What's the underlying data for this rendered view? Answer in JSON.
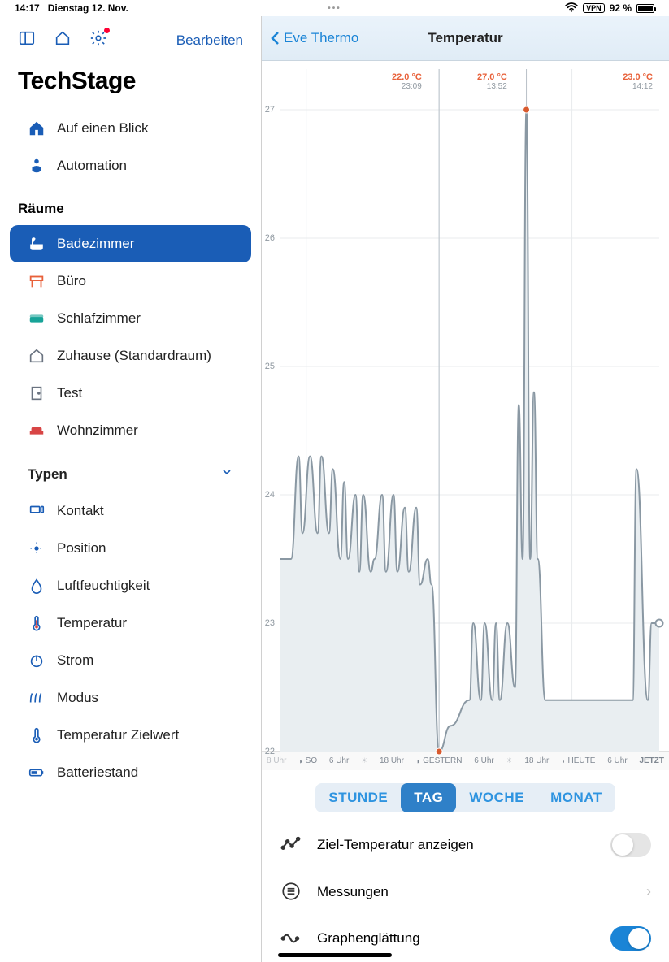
{
  "statusbar": {
    "time": "14:17",
    "date": "Dienstag 12. Nov.",
    "vpn": "VPN",
    "battery": "92 %"
  },
  "sidebar": {
    "edit": "Bearbeiten",
    "app_title": "TechStage",
    "top": [
      {
        "label": "Auf einen Blick"
      },
      {
        "label": "Automation"
      }
    ],
    "rooms_header": "Räume",
    "rooms": [
      {
        "label": "Badezimmer"
      },
      {
        "label": "Büro"
      },
      {
        "label": "Schlafzimmer"
      },
      {
        "label": "Zuhause (Standardraum)"
      },
      {
        "label": "Test"
      },
      {
        "label": "Wohnzimmer"
      }
    ],
    "types_header": "Typen",
    "types": [
      {
        "label": "Kontakt"
      },
      {
        "label": "Position"
      },
      {
        "label": "Luftfeuchtigkeit"
      },
      {
        "label": "Temperatur"
      },
      {
        "label": "Strom"
      },
      {
        "label": "Modus"
      },
      {
        "label": "Temperatur Zielwert"
      },
      {
        "label": "Batteriestand"
      }
    ]
  },
  "content": {
    "back": "Eve Thermo",
    "title": "Temperatur",
    "annotations": [
      {
        "temp": "22.0 °C",
        "time": "23:09"
      },
      {
        "temp": "27.0 °C",
        "time": "13:52"
      },
      {
        "temp": "23.0 °C",
        "time": "14:12"
      }
    ],
    "xaxis": {
      "so": "SO",
      "gestern": "GESTERN",
      "heute": "HEUTE",
      "six": "6 Uhr",
      "eighteen": "18 Uhr",
      "jetzt": "JETZT",
      "eight": "8 Uhr"
    },
    "seg": {
      "hour": "STUNDE",
      "day": "TAG",
      "week": "WOCHE",
      "month": "MONAT"
    },
    "options": {
      "target": "Ziel-Temperatur anzeigen",
      "measure": "Messungen",
      "smooth": "Graphenglättung"
    }
  },
  "chart_data": {
    "type": "line",
    "ylabel": "°C",
    "ylim": [
      22,
      27
    ],
    "y_ticks": [
      22,
      23,
      24,
      25,
      26,
      27
    ],
    "annotations": [
      {
        "x": 0.42,
        "y": 22.0,
        "label": "22.0 °C 23:09"
      },
      {
        "x": 0.65,
        "y": 27.0,
        "label": "27.0 °C 13:52"
      },
      {
        "x": 1.0,
        "y": 23.0,
        "label": "23.0 °C 14:12"
      }
    ],
    "x": [
      0,
      0.03,
      0.05,
      0.06,
      0.08,
      0.1,
      0.11,
      0.13,
      0.14,
      0.16,
      0.17,
      0.18,
      0.2,
      0.21,
      0.22,
      0.24,
      0.25,
      0.27,
      0.28,
      0.3,
      0.31,
      0.33,
      0.34,
      0.36,
      0.37,
      0.39,
      0.4,
      0.42,
      0.45,
      0.5,
      0.51,
      0.53,
      0.54,
      0.56,
      0.57,
      0.58,
      0.6,
      0.62,
      0.63,
      0.64,
      0.65,
      0.66,
      0.67,
      0.68,
      0.7,
      0.73,
      0.85,
      0.88,
      0.93,
      0.94,
      0.97,
      0.98,
      1.0
    ],
    "values": [
      23.5,
      23.5,
      24.3,
      23.7,
      24.3,
      23.7,
      24.3,
      23.7,
      24.2,
      23.5,
      24.1,
      23.5,
      24.0,
      23.4,
      24.0,
      23.4,
      23.5,
      24.0,
      23.4,
      24.0,
      23.4,
      23.9,
      23.4,
      23.9,
      23.3,
      23.5,
      23.3,
      22.0,
      22.2,
      22.4,
      23.0,
      22.4,
      23.0,
      22.4,
      23.0,
      22.4,
      23.0,
      22.5,
      24.7,
      23.5,
      27.0,
      23.5,
      24.8,
      23.5,
      22.4,
      22.4,
      22.4,
      22.4,
      22.4,
      24.2,
      22.4,
      23.0,
      23.0
    ]
  }
}
